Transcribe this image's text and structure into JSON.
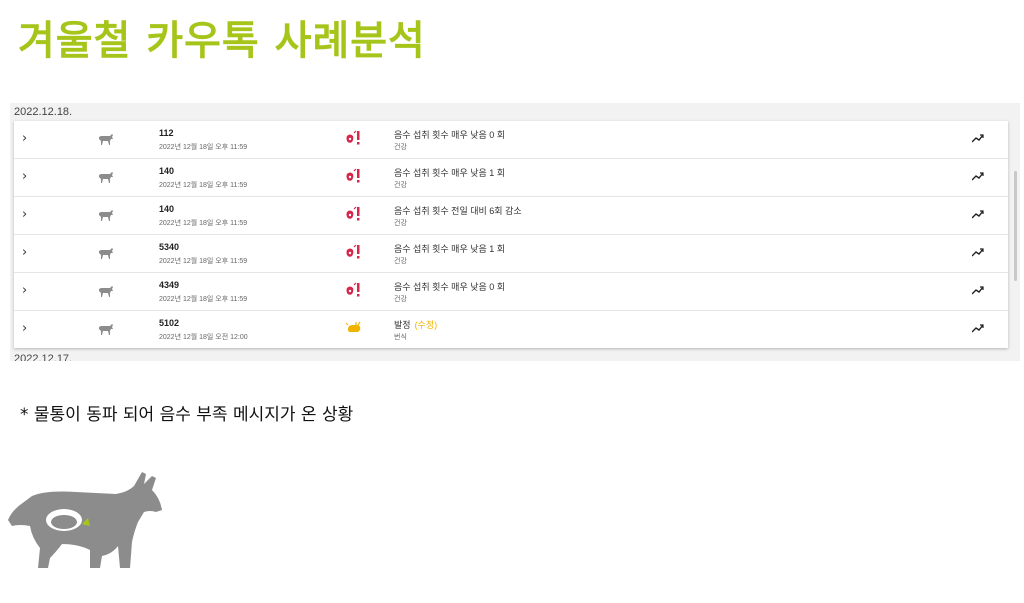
{
  "title": "겨울철 카우톡 사례분석",
  "feed": {
    "groups": [
      {
        "date": "2022.12.18.",
        "rows": [
          {
            "id": "112",
            "time": "2022년 12월 18일 오후 11:59",
            "message": "음수 섭취 횟수 매우 낮음 0 회",
            "extra": "",
            "category": "건강",
            "icon": "health-alert-icon"
          },
          {
            "id": "140",
            "time": "2022년 12월 18일 오후 11:59",
            "message": "음수 섭취 횟수 매우 낮음 1 회",
            "extra": "",
            "category": "건강",
            "icon": "health-alert-icon"
          },
          {
            "id": "140",
            "time": "2022년 12월 18일 오후 11:59",
            "message": "음수 섭취 횟수 전일 대비 6회 감소",
            "extra": "",
            "category": "건강",
            "icon": "health-alert-icon"
          },
          {
            "id": "5340",
            "time": "2022년 12월 18일 오후 11:59",
            "message": "음수 섭취 횟수 매우 낮음 1 회",
            "extra": "",
            "category": "건강",
            "icon": "health-alert-icon"
          },
          {
            "id": "4349",
            "time": "2022년 12월 18일 오후 11:59",
            "message": "음수 섭취 횟수 매우 낮음 0 회",
            "extra": "",
            "category": "건강",
            "icon": "health-alert-icon"
          },
          {
            "id": "5102",
            "time": "2022년 12월 18일 오전 12:00",
            "message": "발정",
            "extra": "(수정)",
            "category": "번식",
            "icon": "estrus-icon"
          }
        ]
      },
      {
        "date": "2022.12.17.",
        "rows": []
      }
    ]
  },
  "note": "* 물통이 동파 되어 음수 부족 메시지가 온 상황",
  "colors": {
    "title": "#a6c51a",
    "health_alert": "#d8254a",
    "estrus": "#f0b400",
    "cow": "#8c8c8c"
  }
}
